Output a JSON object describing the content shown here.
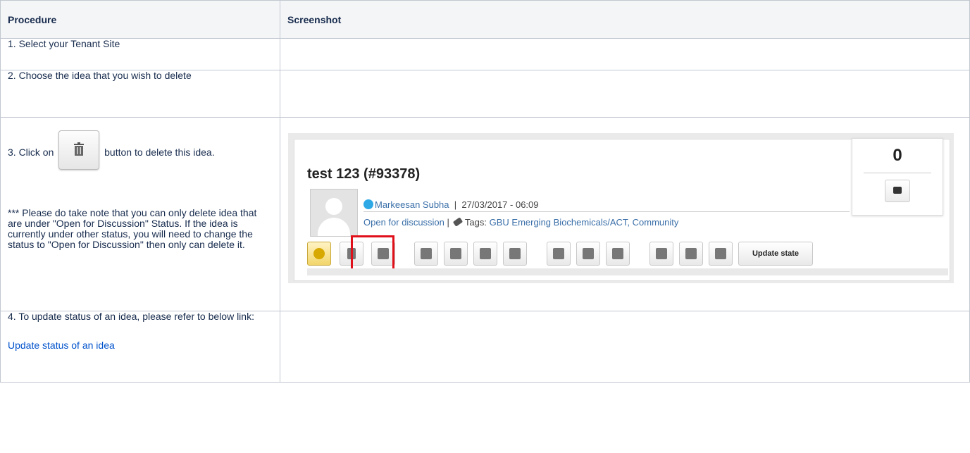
{
  "table": {
    "headers": [
      "Procedure",
      "Screenshot"
    ],
    "rows": [
      {
        "step": "1. Select your Tenant Site"
      },
      {
        "step": "2. Choose the idea that you wish to delete"
      },
      {
        "step_pre": "3. Click on",
        "step_post": "button to delete this idea.",
        "note": "*** Please do take note that you can only delete idea that are under \"Open for Discussion\" Status. If the idea is currently under other status, you will need to change the status to \"Open for Discussion\" then only can delete it."
      },
      {
        "step": "4. To update status of an idea, please refer to below link:",
        "link": "Update status of an idea"
      }
    ]
  },
  "screenshot": {
    "idea_title": "test 123 (#93378)",
    "author": "Markeesan Subha",
    "datetime": "27/03/2017 - 06:09",
    "status_link": "Open for discussion",
    "tags_label": "Tags:",
    "tags": "GBU Emerging Biochemicals/ACT, Community",
    "vote_count": "0",
    "update_button": "Update state",
    "toolbar_icons": [
      "eye-icon",
      "trash-icon",
      "edit-icon",
      "headset-icon",
      "pin-icon",
      "arrows-icon",
      "translate-icon",
      "hierarchy-icon",
      "server-icon",
      "equals-icon",
      "mail-icon",
      "pdf-icon",
      "rss-icon"
    ],
    "highlight_color": "#e0101a"
  }
}
